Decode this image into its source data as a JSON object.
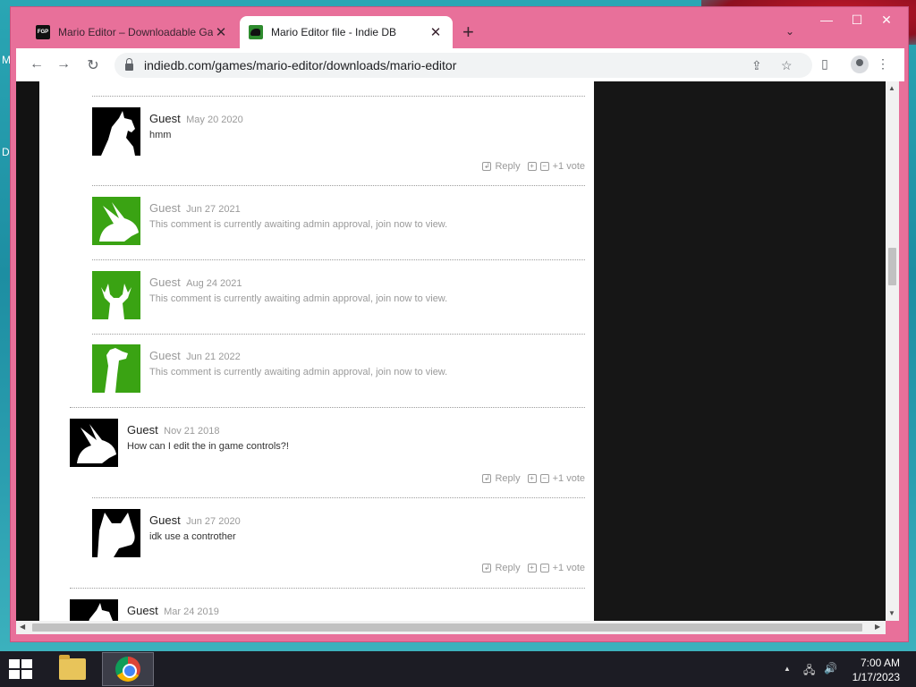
{
  "desktop": {
    "side_letters": [
      "M",
      "D"
    ]
  },
  "browser": {
    "tabs": [
      {
        "title": "Mario Editor – Downloadable Ga",
        "icon": "fgp-favicon",
        "favicon_text": "FGP"
      },
      {
        "title": "Mario Editor file - Indie DB",
        "icon": "indiedb-favicon"
      }
    ],
    "url": "indiedb.com/games/mario-editor/downloads/mario-editor",
    "window_color": "#e8709a"
  },
  "comments": [
    {
      "author": "Guest",
      "date": "May 20 2020",
      "text": "hmm",
      "avatar": "unicorn",
      "pending": false,
      "actions": {
        "reply": "Reply",
        "vote": "+1 vote"
      }
    },
    {
      "author": "Guest",
      "date": "Jun 27 2021",
      "text": "This comment is currently awaiting admin approval, join now to view.",
      "avatar": "rabbit",
      "pending": true
    },
    {
      "author": "Guest",
      "date": "Aug 24 2021",
      "text": "This comment is currently awaiting admin approval, join now to view.",
      "avatar": "deer",
      "pending": true
    },
    {
      "author": "Guest",
      "date": "Jun 21 2022",
      "text": "This comment is currently awaiting admin approval, join now to view.",
      "avatar": "giraffe",
      "pending": true
    },
    {
      "author": "Guest",
      "date": "Nov 21 2018",
      "text": "How can I edit the in game controls?!",
      "avatar": "rabbit",
      "pending": false,
      "actions": {
        "reply": "Reply",
        "vote": "+1 vote"
      }
    },
    {
      "author": "Guest",
      "date": "Jun 27 2020",
      "text": "idk use a controther",
      "avatar": "cat",
      "pending": false,
      "actions": {
        "reply": "Reply",
        "vote": "+1 vote"
      }
    },
    {
      "author": "Guest",
      "date": "Mar 24 2019",
      "text": "",
      "avatar": "unicorn",
      "pending": false
    }
  ],
  "taskbar": {
    "apps": [
      "file-explorer",
      "google-chrome"
    ],
    "time": "7:00 AM",
    "date": "1/17/2023"
  }
}
